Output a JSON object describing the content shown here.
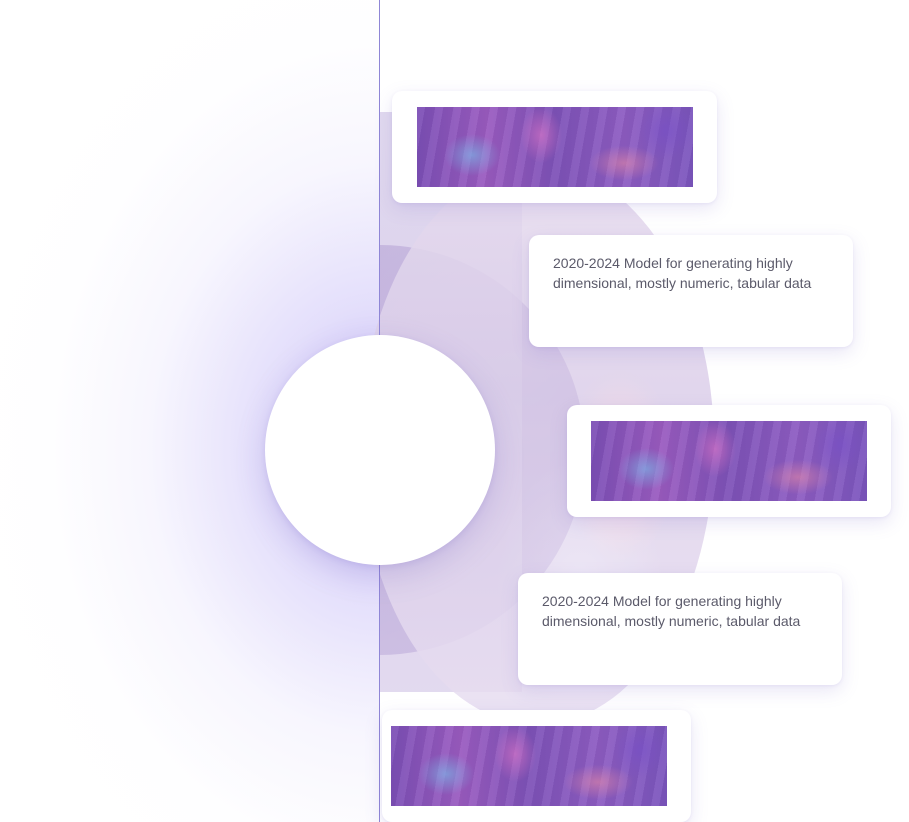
{
  "timeline": {
    "items": [
      {
        "type": "image",
        "image_name": "iridescent-purple-abstract-image"
      },
      {
        "type": "text",
        "text": "2020-2024 Model for generating highly dimensional, mostly numeric, tabular data"
      },
      {
        "type": "image",
        "image_name": "iridescent-purple-abstract-image"
      },
      {
        "type": "text",
        "text": "2020-2024 Model for generating highly dimensional, mostly numeric, tabular data"
      },
      {
        "type": "image",
        "image_name": "iridescent-purple-abstract-image"
      }
    ]
  },
  "colors": {
    "accent": "#8f86d6",
    "glow": "#a08cf0",
    "card_text": "#5b5a6a",
    "image_purple": "#8d5cc2"
  }
}
